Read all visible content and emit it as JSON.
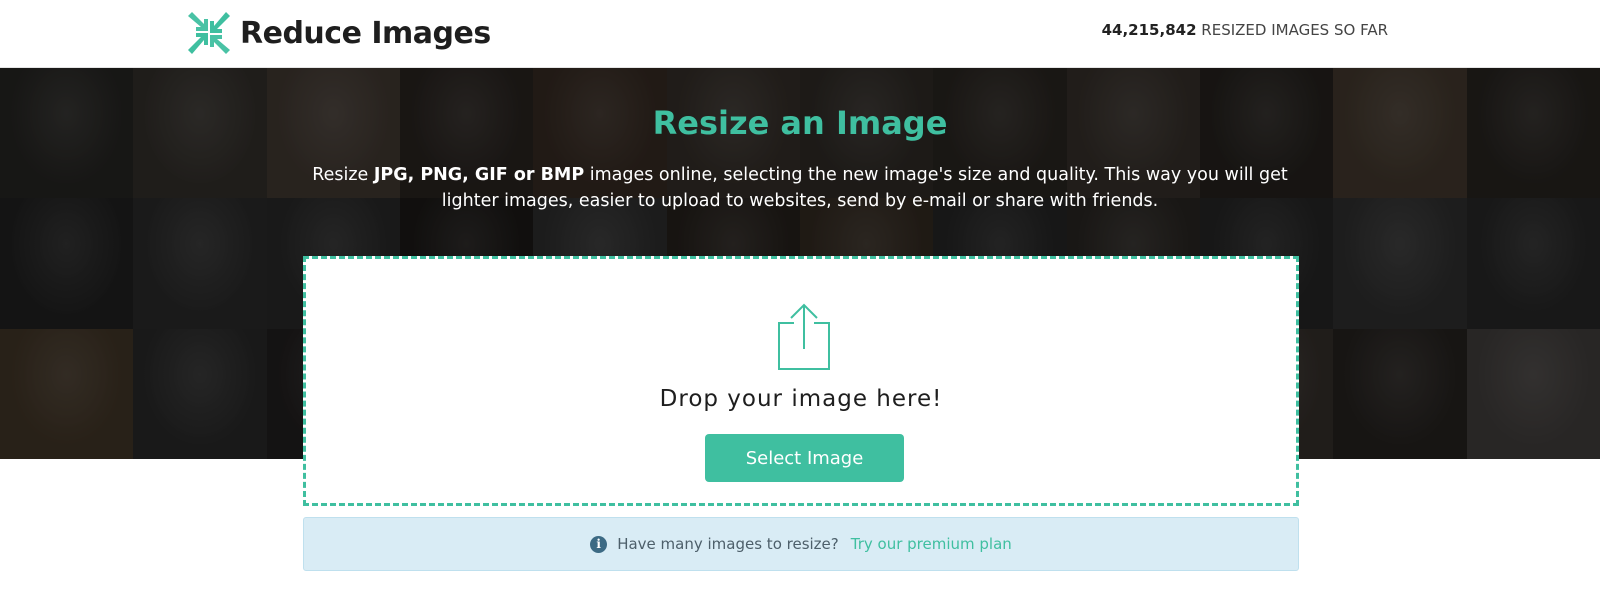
{
  "header": {
    "logo_text": "Reduce Images",
    "counter_value": "44,215,842",
    "counter_label": "RESIZED IMAGES SO FAR"
  },
  "hero": {
    "title": "Resize an Image",
    "desc_prefix": "Resize ",
    "desc_formats": "JPG, PNG, GIF or BMP",
    "desc_suffix": " images online, selecting the new image's size and quality. This way you will get lighter images, easier to upload to websites, send by e-mail or share with friends.",
    "background_tiles": [
      "#2b2a27",
      "#3a3631",
      "#4a4038",
      "#2e2824",
      "#3d3027",
      "#3b342e",
      "#35302b",
      "#2f2a25",
      "#3d3630",
      "#2a2622",
      "#4b3f33",
      "#2c2824",
      "#262626",
      "#303030",
      "#2e2e2e",
      "#1f1c1a",
      "#343434",
      "#2b2520",
      "#3a3026",
      "#2a2a2a",
      "#2f2b27",
      "#2a2a2a",
      "#363636",
      "#2c2c2c",
      "#4a3c2c",
      "#2f2f2f",
      "#262323",
      "#2d2d2d",
      "#3a3a3a",
      "#2d2a28",
      "#2b2b2b",
      "#302c28",
      "#2a2824",
      "#3b3530",
      "#2b2724",
      "#4a4644"
    ]
  },
  "dropzone": {
    "drop_text": "Drop your image here!",
    "select_label": "Select Image"
  },
  "info": {
    "text": "Have many images to resize?",
    "link_text": "Try our premium plan"
  },
  "colors": {
    "accent": "#3fbfa0",
    "info_bg": "#d9ecf5",
    "info_icon": "#3c6a84"
  }
}
